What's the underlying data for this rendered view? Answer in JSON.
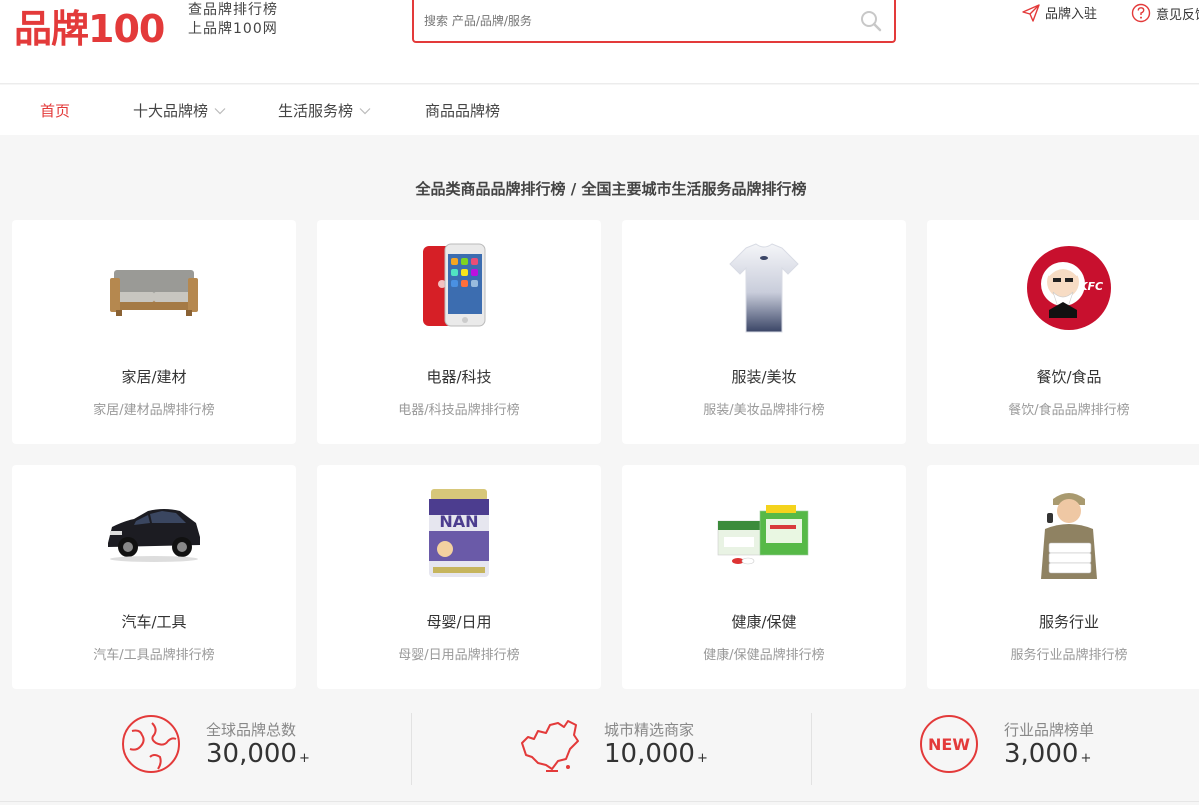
{
  "header": {
    "logo_text": "品牌100",
    "slogan_line1": "查品牌排行榜",
    "slogan_line2": "上品牌100网",
    "search_placeholder": "搜索 产品/品牌/服务",
    "join_label": "品牌入驻",
    "feedback_label": "意见反馈"
  },
  "nav": {
    "items": [
      {
        "label": "首页"
      },
      {
        "label": "十大品牌榜"
      },
      {
        "label": "生活服务榜"
      },
      {
        "label": "商品品牌榜"
      }
    ]
  },
  "section_title": "全品类商品品牌排行榜 / 全国主要城市生活服务品牌排行榜",
  "categories": [
    {
      "name": "家居/建材",
      "sub": "家居/建材品牌排行榜",
      "icon": "sofa-image"
    },
    {
      "name": "电器/科技",
      "sub": "电器/科技品牌排行榜",
      "icon": "phone-image"
    },
    {
      "name": "服装/美妆",
      "sub": "服装/美妆品牌排行榜",
      "icon": "tshirt-image"
    },
    {
      "name": "餐饮/食品",
      "sub": "餐饮/食品品牌排行榜",
      "icon": "kfc-logo-image"
    },
    {
      "name": "汽车/工具",
      "sub": "汽车/工具品牌排行榜",
      "icon": "car-image"
    },
    {
      "name": "母婴/日用",
      "sub": "母婴/日用品牌排行榜",
      "icon": "milk-powder-image"
    },
    {
      "name": "健康/保健",
      "sub": "健康/保健品牌排行榜",
      "icon": "medicine-box-image"
    },
    {
      "name": "服务行业",
      "sub": "服务行业品牌排行榜",
      "icon": "delivery-man-image"
    }
  ],
  "stats": [
    {
      "label": "全球品牌总数",
      "value": "30,000",
      "suffix": "+",
      "icon": "globe-icon"
    },
    {
      "label": "城市精选商家",
      "value": "10,000",
      "suffix": "+",
      "icon": "china-map-icon"
    },
    {
      "label": "行业品牌榜单",
      "value": "3,000",
      "suffix": "+",
      "icon": "new-badge-icon",
      "badge_text": "NEW"
    }
  ],
  "colors": {
    "accent": "#e33a3a",
    "background": "#f6f6f6"
  }
}
